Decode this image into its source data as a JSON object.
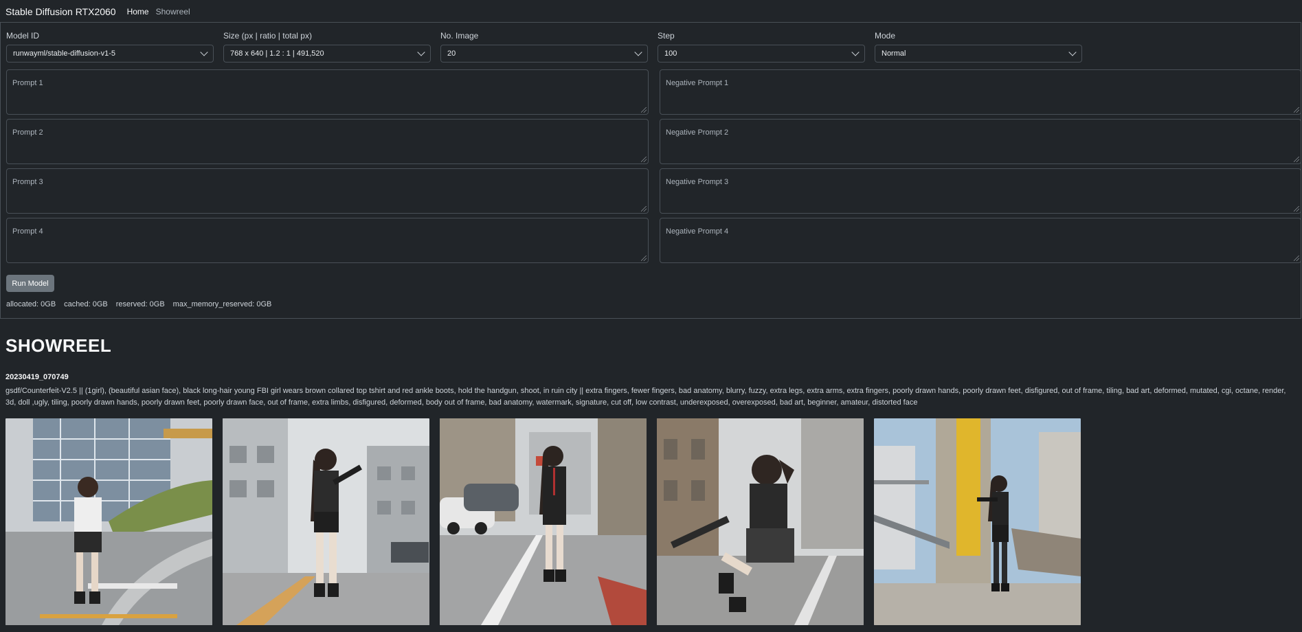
{
  "navbar": {
    "brand": "Stable Diffusion RTX2060",
    "links": [
      "Home",
      "Showreel"
    ]
  },
  "form": {
    "model_id": {
      "label": "Model ID",
      "value": "runwayml/stable-diffusion-v1-5"
    },
    "size": {
      "label": "Size (px | ratio | total px)",
      "value": "768 x 640 | 1.2 : 1 | 491,520"
    },
    "num_image": {
      "label": "No. Image",
      "value": "20"
    },
    "step": {
      "label": "Step",
      "value": "100"
    },
    "mode": {
      "label": "Mode",
      "value": "Normal"
    },
    "prompts": [
      "Prompt 1",
      "Prompt 2",
      "Prompt 3",
      "Prompt 4"
    ],
    "negative_prompts": [
      "Negative Prompt 1",
      "Negative Prompt 2",
      "Negative Prompt 3",
      "Negative Prompt 4"
    ],
    "run_label": "Run Model"
  },
  "memory": {
    "allocated": "allocated: 0GB",
    "cached": "cached: 0GB",
    "reserved": "reserved: 0GB",
    "max_memory_reserved": "max_memory_reserved: 0GB"
  },
  "showreel": {
    "heading": "SHOWREEL",
    "entries": [
      {
        "timestamp": "20230419_070749",
        "prompt": "gsdf/Counterfeit-V2.5 || (1girl), (beautiful asian face), black long-hair young FBI girl wears brown collared top tshirt and red ankle boots, hold the handgun, shoot, in ruin city ||    extra fingers, fewer fingers, bad anatomy, blurry, fuzzy, extra legs, extra arms, extra fingers, poorly drawn hands, poorly drawn feet, disfigured, out of frame, tiling, bad art, deformed, mutated, cgi, octane, render, 3d, doll ,ugly, tiling, poorly drawn hands, poorly drawn feet, poorly drawn face, out of frame, extra limbs, disfigured, deformed, body out of frame, bad anatomy, watermark, signature, cut off, low contrast, underexposed, overexposed, bad art, beginner, amateur, distorted face"
      }
    ]
  }
}
